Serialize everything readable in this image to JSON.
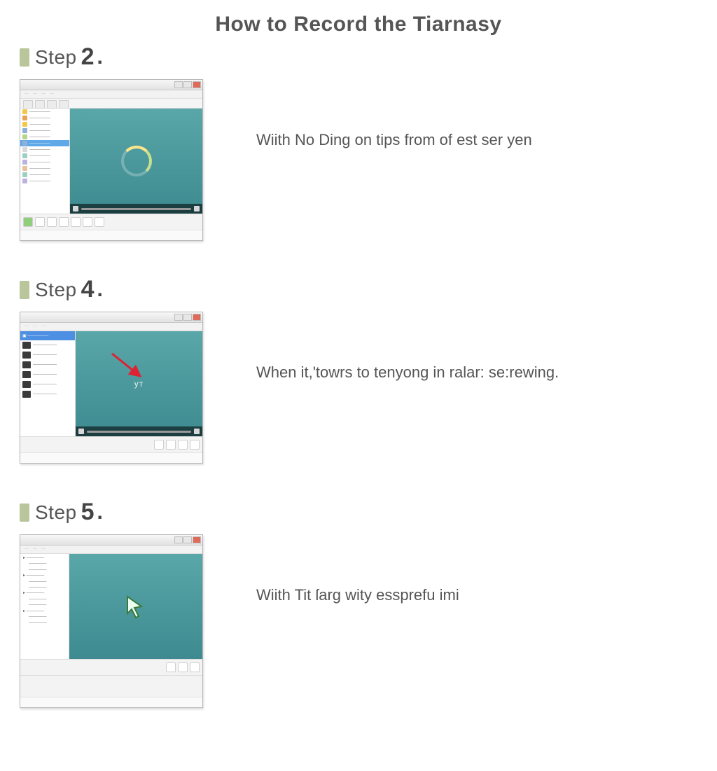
{
  "title": "How to Record the Tiarnasy",
  "accent": "#b9c69b",
  "steps": [
    {
      "label": "Step",
      "number": "2",
      "desc": "Wiith No Ding on tips from of est ser yen",
      "variant": "v2",
      "sidebar_items": [
        {
          "color": "#f2c84b",
          "label": ""
        },
        {
          "color": "#e8a35a",
          "label": ""
        },
        {
          "color": "#f2c84b",
          "label": ""
        },
        {
          "color": "#8fb0d9",
          "label": ""
        },
        {
          "color": "#b7d48a",
          "label": ""
        },
        {
          "color": "#8fb0d9",
          "label": "",
          "sel": true
        },
        {
          "color": "#d9d9d9",
          "label": ""
        },
        {
          "color": "#9bd1c2",
          "label": ""
        },
        {
          "color": "#bcb2e0",
          "label": ""
        },
        {
          "color": "#e8c2a0",
          "label": ""
        },
        {
          "color": "#9bd1c2",
          "label": ""
        },
        {
          "color": "#bcb2e0",
          "label": ""
        }
      ]
    },
    {
      "label": "Step",
      "number": "4",
      "desc": "When it,'towrs to tenyong in ralar: se:rewing.",
      "variant": "v4",
      "icon_label": "yᴛ",
      "sidebar_items": [
        {
          "label": ""
        },
        {
          "label": ""
        },
        {
          "label": ""
        },
        {
          "label": ""
        },
        {
          "label": ""
        },
        {
          "label": ""
        }
      ]
    },
    {
      "label": "Step",
      "number": "5",
      "desc": "Wiith Tit ſarg wity essprefu imi",
      "variant": "v5",
      "tree": [
        "",
        "",
        "",
        "",
        "",
        "",
        "",
        "",
        "",
        "",
        "",
        ""
      ]
    }
  ]
}
